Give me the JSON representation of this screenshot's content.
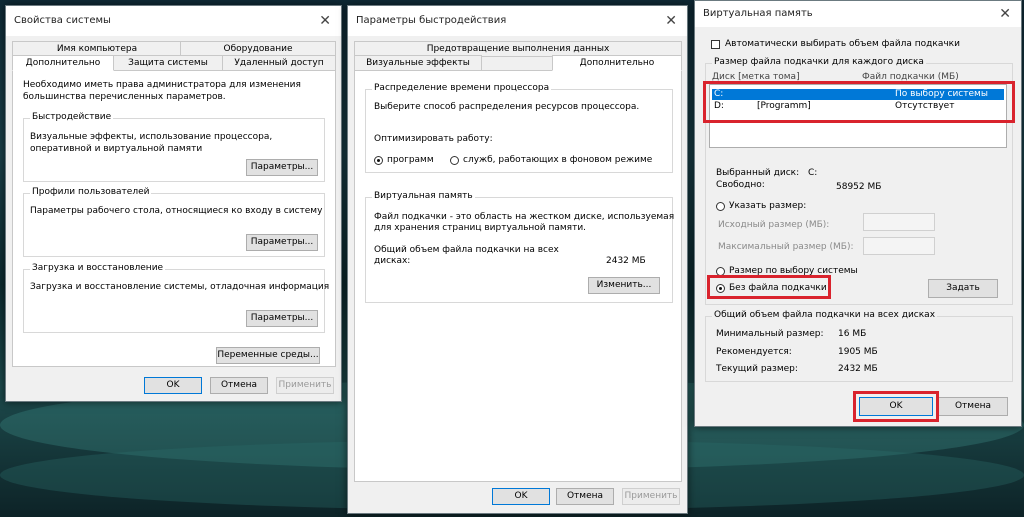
{
  "sysprops": {
    "title": "Свойства системы",
    "tabs_row1": [
      "Имя компьютера",
      "Оборудование"
    ],
    "tabs_row2": [
      "Дополнительно",
      "Защита системы",
      "Удаленный доступ"
    ],
    "intro": "Необходимо иметь права администратора для изменения большинства перечисленных параметров.",
    "perf": {
      "title": "Быстродействие",
      "text": "Визуальные эффекты, использование процессора, оперативной и виртуальной памяти",
      "button": "Параметры..."
    },
    "profiles": {
      "title": "Профили пользователей",
      "text": "Параметры рабочего стола, относящиеся ко входу в систему",
      "button": "Параметры..."
    },
    "startup": {
      "title": "Загрузка и восстановление",
      "text": "Загрузка и восстановление системы, отладочная информация",
      "button": "Параметры..."
    },
    "env_button": "Переменные среды...",
    "ok": "OK",
    "cancel": "Отмена",
    "apply": "Применить"
  },
  "perfopts": {
    "title": "Параметры быстродействия",
    "tab_top": "Предотвращение выполнения данных",
    "tab_left": "Визуальные эффекты",
    "tab_right": "Дополнительно",
    "cpu": {
      "title": "Распределение времени процессора",
      "text": "Выберите способ распределения ресурсов процессора.",
      "optimize": "Оптимизировать работу:",
      "opt_programs": "программ",
      "opt_services": "служб, работающих в фоновом режиме"
    },
    "vm": {
      "title": "Виртуальная память",
      "text1": "Файл подкачки - это область на жестком диске, используемая",
      "text2": "для хранения страниц виртуальной памяти.",
      "total_label1": "Общий объем файла подкачки на всех",
      "total_label2": "дисках:",
      "total_value": "2432 МБ",
      "change_button": "Изменить..."
    },
    "ok": "OK",
    "cancel": "Отмена",
    "apply": "Применить"
  },
  "vmem": {
    "title": "Виртуальная память",
    "auto_label": "Автоматически выбирать объем файла подкачки",
    "per_disk_title": "Размер файла подкачки для каждого диска",
    "col_disk": "Диск [метка тома]",
    "col_size": "Файл подкачки (МБ)",
    "drives": [
      {
        "disk": "C:",
        "label": "",
        "size": "По выбору системы"
      },
      {
        "disk": "D:",
        "label": "[Programm]",
        "size": "Отсутствует"
      }
    ],
    "selected_label": "Выбранный диск:",
    "selected_value": "C:",
    "free_label": "Свободно:",
    "free_value": "58952 МБ",
    "custom_label": "Указать размер:",
    "initial_label": "Исходный размер (МБ):",
    "max_label": "Максимальный размер (МБ):",
    "system_label": "Размер по выбору системы",
    "nopage_label": "Без файла подкачки",
    "set_button": "Задать",
    "total_title": "Общий объем файла подкачки на всех дисках",
    "min_label": "Минимальный размер:",
    "min_value": "16 МБ",
    "rec_label": "Рекомендуется:",
    "rec_value": "1905 МБ",
    "cur_label": "Текущий размер:",
    "cur_value": "2432 МБ",
    "ok": "OK",
    "cancel": "Отмена"
  },
  "colors": {
    "highlight": "#d9232d",
    "selection": "#0078d7"
  }
}
